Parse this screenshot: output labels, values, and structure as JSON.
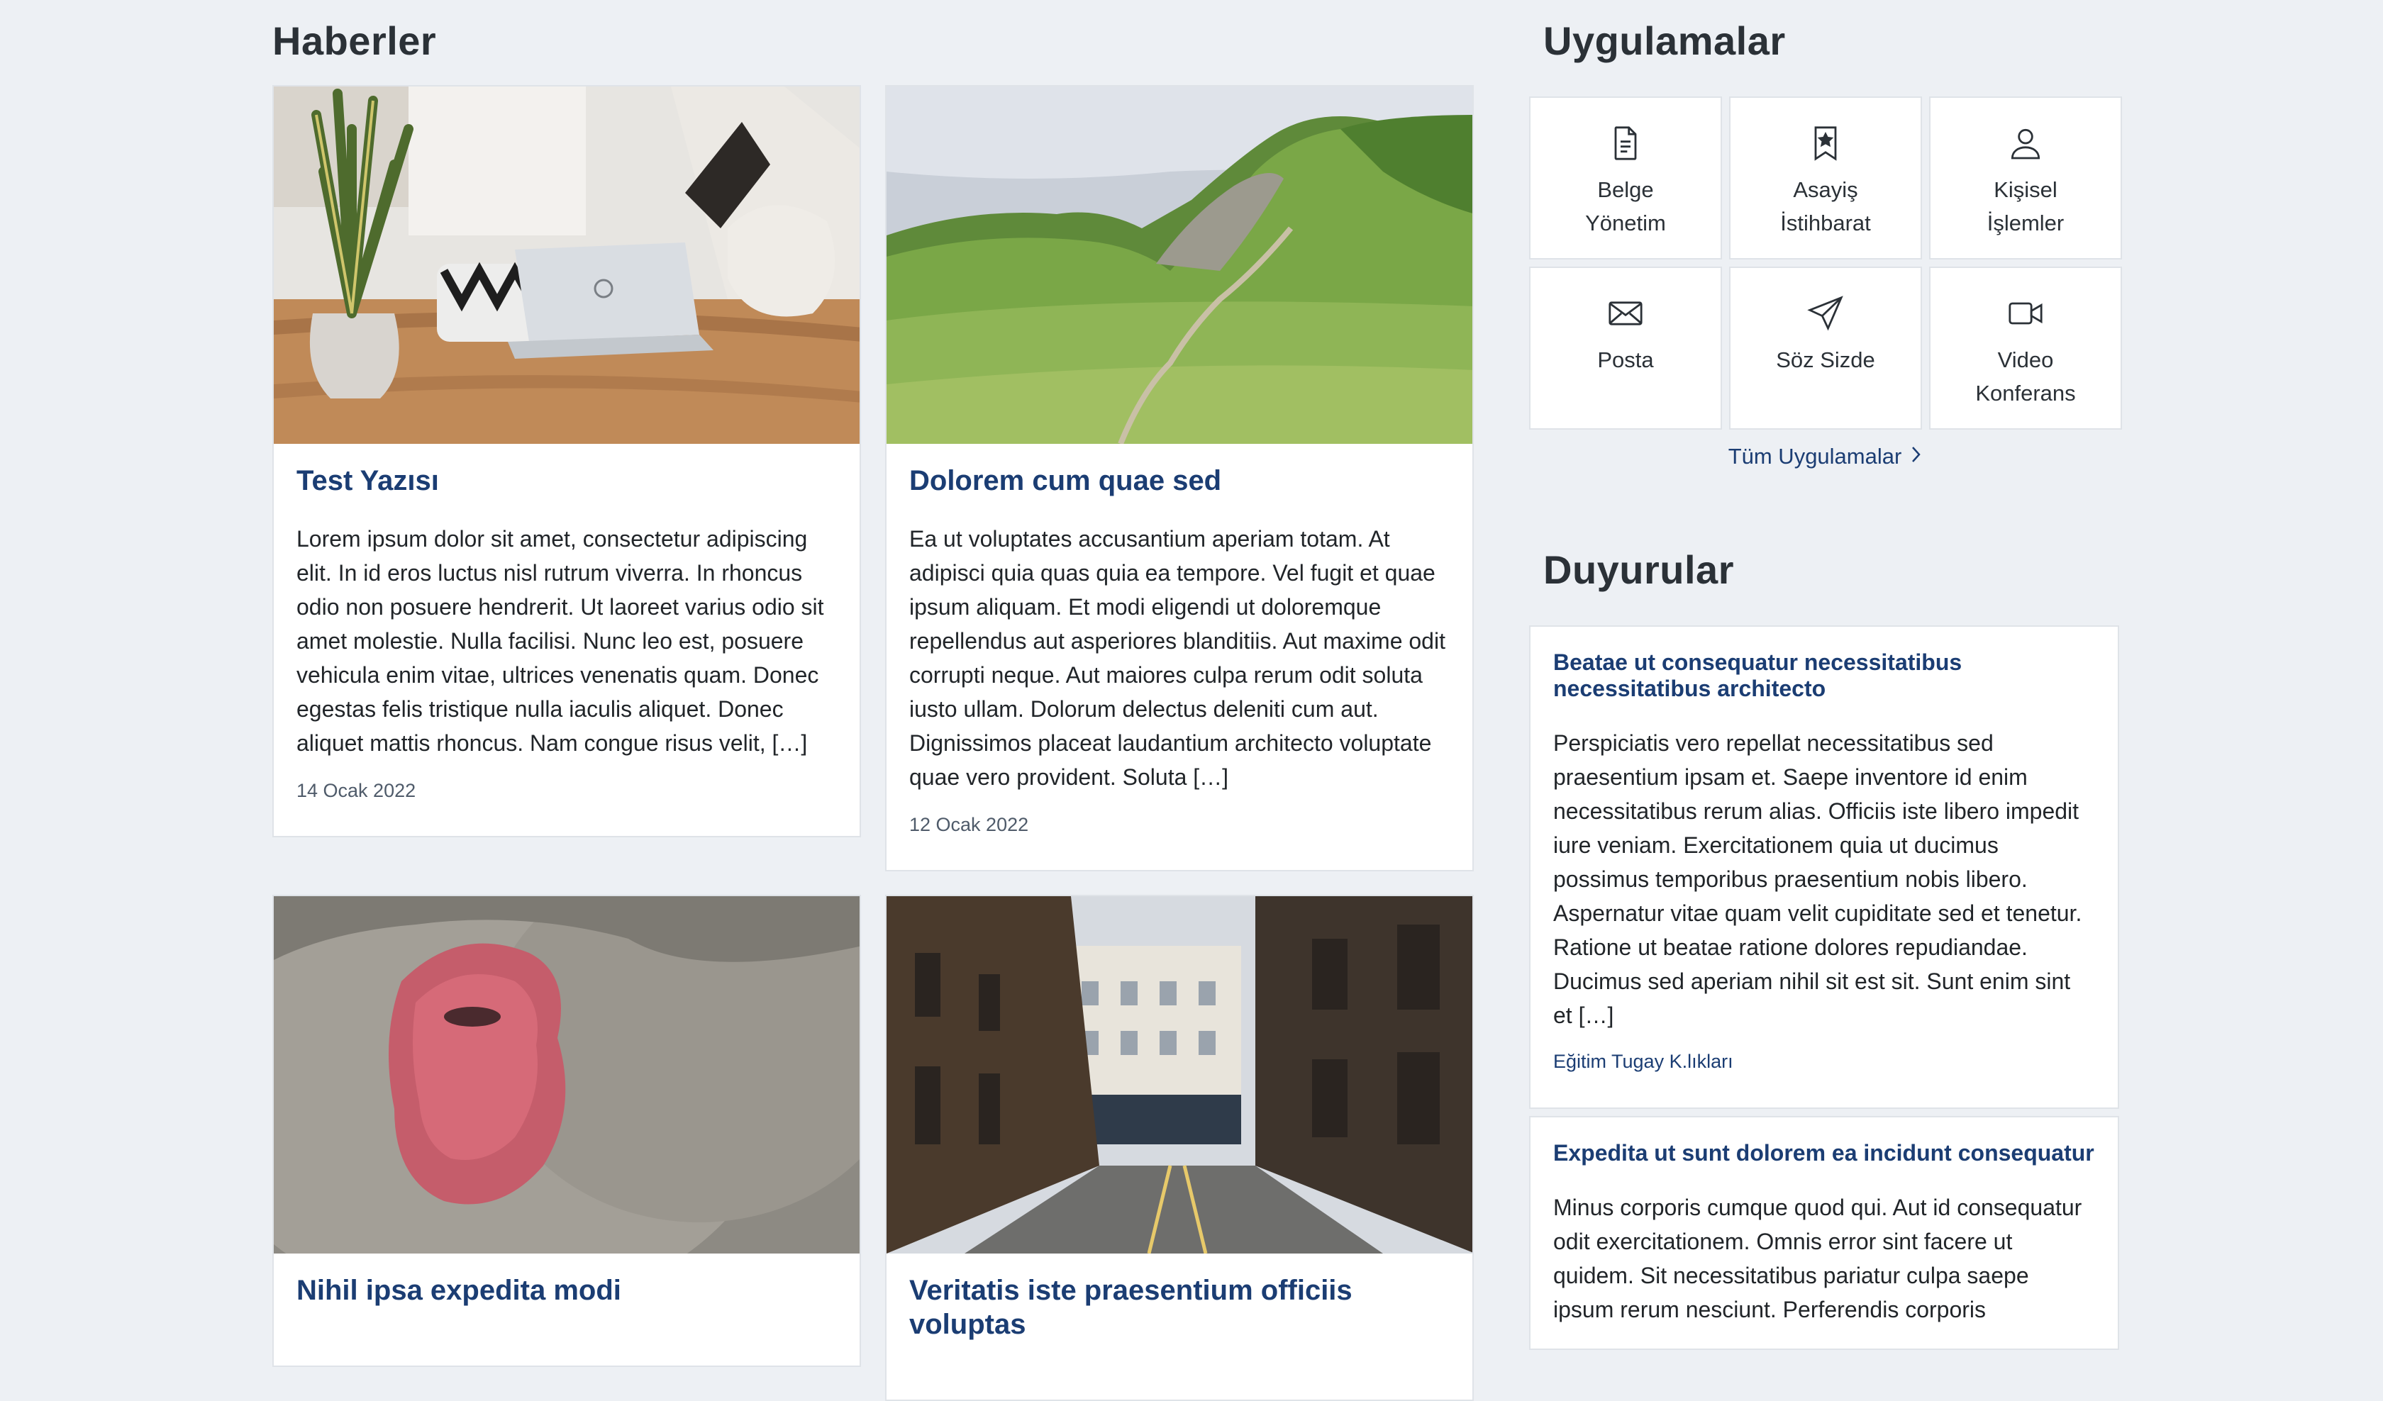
{
  "sections": {
    "news": "Haberler",
    "apps": "Uygulamalar",
    "announcements": "Duyurular"
  },
  "news": [
    {
      "title": "Test Yazısı",
      "text": "Lorem ipsum dolor sit amet, consectetur adipiscing elit. In id eros luctus nisl rutrum viverra. In rhoncus odio non posuere hendrerit. Ut laoreet varius odio sit amet molestie. Nulla facilisi. Nunc leo est, posuere vehicula enim vitae, ultrices venenatis quam. Donec egestas felis tristique nulla iaculis aliquet. Donec aliquet mattis rhoncus. Nam congue risus velit, […]",
      "date": "14 Ocak 2022"
    },
    {
      "title": "Dolorem cum quae sed",
      "text": "Ea ut voluptates accusantium aperiam totam. At adipisci quia quas quia ea tempore. Vel fugit et quae ipsum aliquam. Et modi eligendi ut doloremque repellendus aut asperiores blanditiis. Aut maxime odit corrupti neque. Aut maiores culpa rerum odit soluta iusto ullam. Dolorum delectus deleniti cum aut. Dignissimos placeat laudantium architecto voluptate quae vero provident. Soluta […]",
      "date": "12 Ocak 2022"
    },
    {
      "title": "Nihil ipsa expedita modi"
    },
    {
      "title": "Veritatis iste praesentium officiis voluptas"
    }
  ],
  "apps": [
    {
      "label": "Belge\nYönetim",
      "icon": "document-icon"
    },
    {
      "label": "Asayiş\nİstihbarat",
      "icon": "bookmark-star-icon"
    },
    {
      "label": "Kişisel\nİşlemler",
      "icon": "person-icon"
    },
    {
      "label": "Posta",
      "icon": "envelope-icon"
    },
    {
      "label": "Söz Sizde",
      "icon": "send-icon"
    },
    {
      "label": "Video\nKonferans",
      "icon": "camera-video-icon"
    }
  ],
  "all_apps_label": "Tüm Uygulamalar",
  "announcements": [
    {
      "title": "Beatae ut consequatur necessitatibus necessitatibus architecto",
      "text": "Perspiciatis vero repellat necessitatibus sed praesentium ipsam et. Saepe inventore id enim necessitatibus rerum alias. Officiis iste libero impedit iure veniam. Exercitationem quia ut ducimus possimus temporibus praesentium nobis libero. Aspernatur vitae quam velit cupiditate sed et tenetur. Ratione ut beatae ratione dolores repudiandae. Ducimus sed aperiam nihil sit est sit. Sunt enim sint et […]",
      "source": "Eğitim Tugay K.lıkları"
    },
    {
      "title": "Expedita ut sunt dolorem ea incidunt consequatur",
      "text": "Minus corporis cumque quod qui. Aut id consequatur odit exercitationem. Omnis error sint facere ut quidem. Sit necessitatibus pariatur culpa saepe ipsum rerum nesciunt. Perferendis corporis"
    }
  ]
}
